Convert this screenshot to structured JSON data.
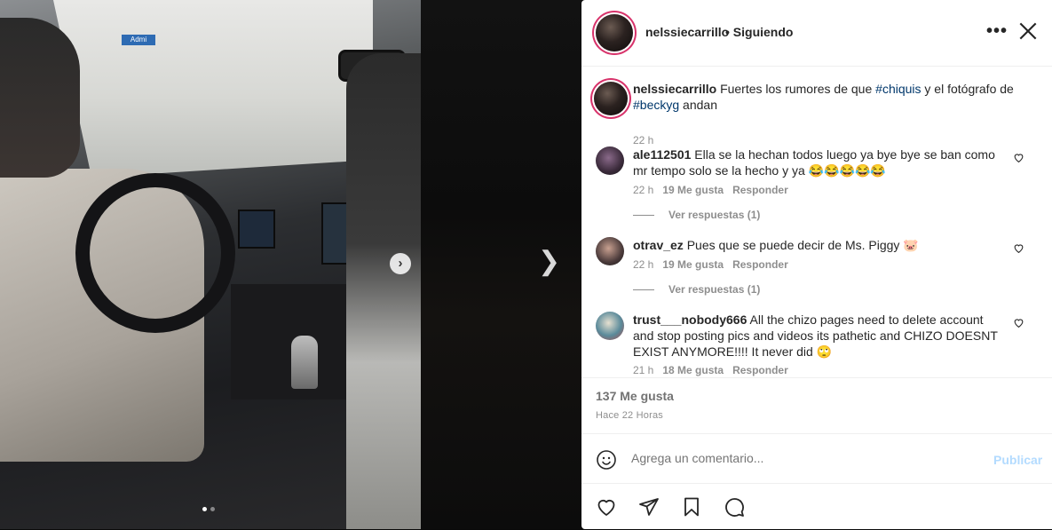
{
  "media": {
    "street_sign": "Admi",
    "carousel_total": 2,
    "carousel_active": 1
  },
  "post": {
    "username": "nelssiecarrillo",
    "follow_status": "• Siguiendo",
    "more_icon": "more-horizontal-icon",
    "close_icon": "close-icon",
    "caption": {
      "username": "nelssiecarrillo",
      "text_before": "Fuertes los rumores de que ",
      "tag1": "#chiquis",
      "text_middle": " y el fotógrafo de ",
      "tag2": "#beckyg",
      "text_after": " andan",
      "time": "22 h"
    },
    "comments": [
      {
        "username": "ale112501",
        "text": "Ella se la hechan todos luego ya bye bye se ban como mr tempo solo se la hecho y ya 😂😂😂😂😂",
        "time": "22 h",
        "likes": "19 Me gusta",
        "reply": "Responder",
        "view_replies": "Ver respuestas (1)"
      },
      {
        "username": "otrav_ez",
        "text": "Pues que se puede decir de Ms. Piggy 🐷",
        "time": "22 h",
        "likes": "19 Me gusta",
        "reply": "Responder",
        "view_replies": "Ver respuestas (1)"
      },
      {
        "username": "trust___nobody666",
        "text": "All the chizo pages need to delete account and stop posting pics and videos its pathetic and CHIZO DOESNT EXIST ANYMORE!!!! It never did 🙄",
        "time": "21 h",
        "likes": "18 Me gusta",
        "reply": "Responder"
      }
    ],
    "likes_count": "137 Me gusta",
    "posted_ago": "Hace 22 Horas",
    "comment_placeholder": "Agrega un comentario...",
    "publish_label": "Publicar",
    "colors": {
      "link": "#00376b",
      "muted": "#8e8e8e",
      "publish_disabled": "#b3dbff",
      "story_ring": "#d8336b"
    }
  }
}
